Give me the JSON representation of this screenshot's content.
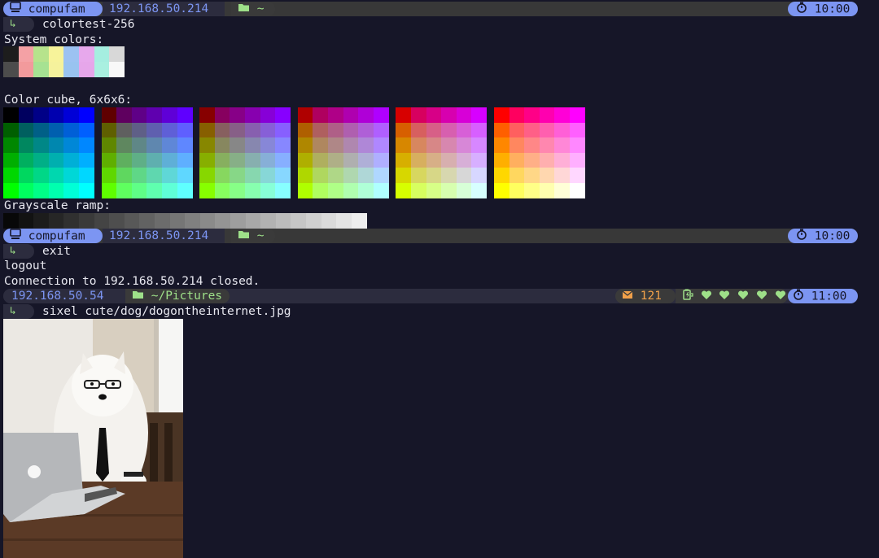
{
  "session1": {
    "host": "compufam",
    "ip": "192.168.50.214",
    "dir": "~",
    "time": "10:00"
  },
  "session1b": {
    "host": "compufam",
    "ip": "192.168.50.214",
    "dir": "~",
    "time": "10:00"
  },
  "session2": {
    "ip": "192.168.50.54",
    "dir": "~/Pictures",
    "mail_count": "121",
    "time": "11:00"
  },
  "terminal": {
    "prompt_glyph": "↳",
    "cmd1": "colortest-256",
    "system_colors_label": "System colors:",
    "color_cube_label": "Color cube, 6x6x6:",
    "grayscale_label": "Grayscale ramp:",
    "cmd2": "exit",
    "logout": "logout",
    "connection_closed": "Connection to 192.168.50.214 closed.",
    "cmd3": "sixel cute/dog/dogontheinternet.jpg"
  },
  "colors": {
    "accent": "#7c95f2",
    "green": "#9ee089",
    "orange": "#f0a04a",
    "background": "#161628"
  }
}
